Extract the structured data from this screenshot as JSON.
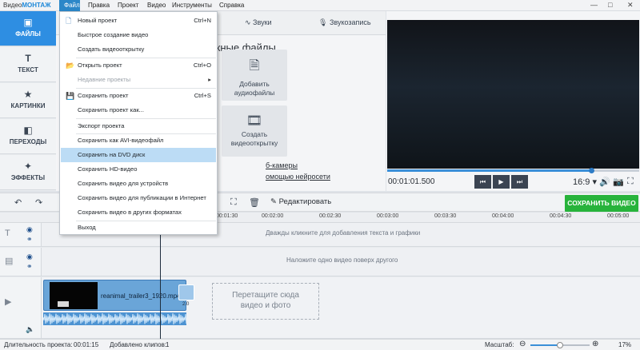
{
  "app": {
    "brand_prefix": "Видео",
    "brand_suffix": "МОНТАЖ"
  },
  "menubar": [
    "Файл",
    "Правка",
    "Проект",
    "Видео",
    "Инструменты",
    "Справка"
  ],
  "window_controls": [
    "—",
    "□",
    "✕"
  ],
  "sidebar": [
    {
      "label": "ФАЙЛЫ",
      "icon": "image-icon",
      "active": true
    },
    {
      "label": "ТЕКСТ",
      "icon": "text-icon"
    },
    {
      "label": "КАРТИНКИ",
      "icon": "star-icon"
    },
    {
      "label": "ПЕРЕХОДЫ",
      "icon": "transitions-icon"
    },
    {
      "label": "ЭФФЕКТЫ",
      "icon": "magic-wand-icon"
    }
  ],
  "panel": {
    "tabs": [
      "Звуки",
      "Звукозапись"
    ],
    "section_title": "ужные файлы",
    "tiles": [
      {
        "label": "Добавить\nаудиофайлы",
        "icon": "audio-file-icon"
      },
      {
        "label": "Создать\nвидеооткрытку",
        "icon": "film-icon"
      }
    ],
    "links": [
      "б-камеры",
      "омощью нейросети"
    ]
  },
  "file_menu": [
    {
      "label": "Новый проект",
      "shortcut": "Ctrl+N",
      "icon": "new-file-icon"
    },
    {
      "label": "Быстрое создание видео"
    },
    {
      "label": "Создать видеооткрытку"
    },
    {
      "label": "Открыть проект",
      "shortcut": "Ctrl+O",
      "icon": "folder-icon"
    },
    {
      "label": "Недавние проекты",
      "disabled": true,
      "submenu": true
    },
    {
      "label": "Сохранить проект",
      "shortcut": "Ctrl+S",
      "icon": "save-icon"
    },
    {
      "label": "Сохранить проект как..."
    },
    {
      "label": "Экспорт проекта"
    },
    {
      "label": "Сохранить как AVI-видеофайл"
    },
    {
      "label": "Сохранить на DVD диск",
      "highlighted": true
    },
    {
      "label": "Сохранить HD-видео"
    },
    {
      "label": "Сохранить видео для устройств"
    },
    {
      "label": "Сохранить видео для публикации в Интернет"
    },
    {
      "label": "Сохранить видео в других форматах"
    },
    {
      "label": "Выход"
    }
  ],
  "preview": {
    "timecode": "00:01:01.500",
    "aspect": "16:9",
    "progress_fraction": 0.81,
    "controls": [
      "⏮",
      "▶",
      "⏭"
    ]
  },
  "toolbar": {
    "edit_label": "Редактировать",
    "save_video_label": "СОХРАНИТЬ ВИДЕО"
  },
  "ruler_ticks": [
    "00:01:30",
    "00:02:00",
    "00:02:30",
    "00:03:00",
    "00:03:30",
    "00:04:00",
    "00:04:30",
    "00:05:00"
  ],
  "tracks": {
    "text_hint": "Дважды кликните для добавления текста и графики",
    "overlay_hint": "Наложите одно видео поверх другого",
    "clip_name": "reanimal_trailer3_1920.mp4",
    "clip_duration": "2.0",
    "drop_hint": "Перетащите сюда\nвидео и фото"
  },
  "status": {
    "duration_label": "Длительность проекта:",
    "duration_value": "00:01:15",
    "clips_label": "Добавлено клипов:",
    "clips_value": "1",
    "scale_label": "Масштаб:",
    "zoom_percent": "17%",
    "zoom_fraction": 0.5
  },
  "colors": {
    "accent": "#2e8ee2",
    "save_green": "#27b33b",
    "menu_highlight": "#bcdcf5"
  }
}
